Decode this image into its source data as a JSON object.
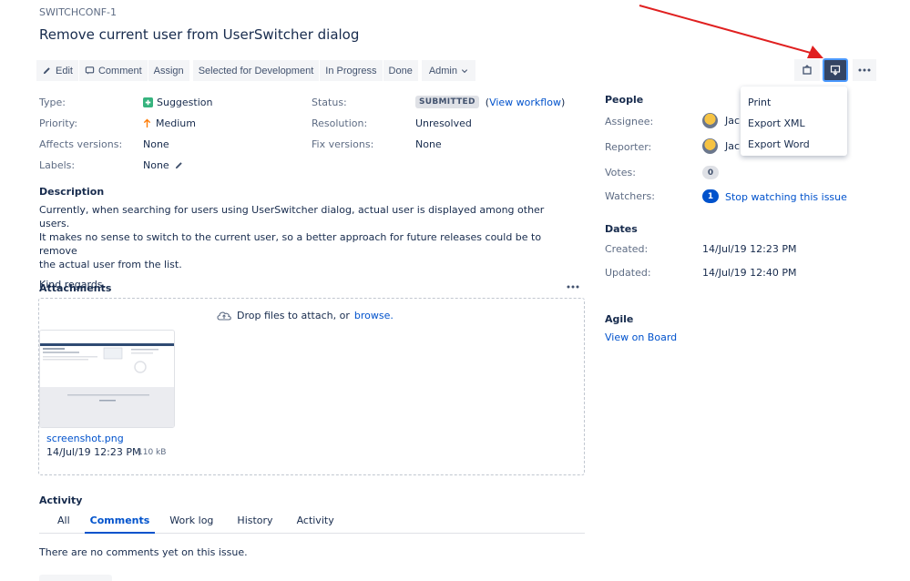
{
  "issue": {
    "key": "SWITCHCONF-1",
    "title": "Remove current user from UserSwitcher dialog"
  },
  "toolbar": {
    "edit": "Edit",
    "comment": "Comment",
    "assign": "Assign",
    "selected_for_development": "Selected for Development",
    "in_progress": "In Progress",
    "done": "Done",
    "admin": "Admin"
  },
  "export_menu": {
    "items": [
      "Print",
      "Export XML",
      "Export Word"
    ]
  },
  "details": {
    "type_label": "Type:",
    "type_value": "Suggestion",
    "priority_label": "Priority:",
    "priority_value": "Medium",
    "affects_label": "Affects versions:",
    "affects_value": "None",
    "labels_label": "Labels:",
    "labels_value": "None",
    "status_label": "Status:",
    "status_value": "SUBMITTED",
    "view_workflow_open": "(",
    "view_workflow": "View workflow",
    "view_workflow_close": ")",
    "resolution_label": "Resolution:",
    "resolution_value": "Unresolved",
    "fix_label": "Fix versions:",
    "fix_value": "None"
  },
  "description": {
    "title": "Description",
    "line1": "Currently, when searching for users using UserSwitcher dialog, actual user is displayed among other users.",
    "line2": "It makes no sense to switch to the current user, so a better approach for future releases could be to remove",
    "line3": "the actual user from the list.",
    "line4": "Kind regards."
  },
  "attachments": {
    "title": "Attachments",
    "drop_text": "Drop files to attach, or",
    "browse": "browse.",
    "file_name": "screenshot.png",
    "file_date": "14/Jul/19 12:23 PM",
    "file_size": "110 kB"
  },
  "activity": {
    "title": "Activity",
    "tabs": [
      "All",
      "Comments",
      "Work log",
      "History",
      "Activity"
    ],
    "active_tab": "Comments",
    "empty": "There are no comments yet on this issue."
  },
  "people": {
    "title": "People",
    "assignee_label": "Assignee:",
    "assignee_value": "Jac",
    "reporter_label": "Reporter:",
    "reporter_value": "Jac",
    "votes_label": "Votes:",
    "votes_value": "0",
    "watchers_label": "Watchers:",
    "watchers_value": "1",
    "stop_watching": "Stop watching this issue"
  },
  "dates": {
    "title": "Dates",
    "created_label": "Created:",
    "created_value": "14/Jul/19 12:23 PM",
    "updated_label": "Updated:",
    "updated_value": "14/Jul/19 12:40 PM"
  },
  "agile": {
    "title": "Agile",
    "view_on_board": "View on Board"
  },
  "colors": {
    "link": "#0052cc",
    "arrow": "#e02020",
    "export_button": "#344563"
  }
}
